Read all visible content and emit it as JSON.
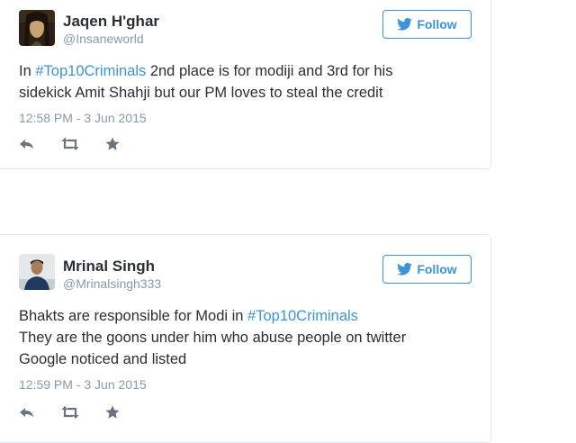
{
  "tweets": [
    {
      "display_name": "Jaqen H'ghar",
      "handle": "@Insaneworld",
      "follow_label": "Follow",
      "text_lines": [
        {
          "before": "In ",
          "hashtag": "#Top10Criminals",
          "after": " 2nd place is for modiji and 3rd for his"
        },
        {
          "before": "sidekick Amit Shahji but our PM loves to steal the credit",
          "hashtag": "",
          "after": ""
        }
      ],
      "timestamp": "12:58 PM - 3 Jun 2015"
    },
    {
      "display_name": "Mrinal Singh",
      "handle": "@Mrinalsingh333",
      "follow_label": "Follow",
      "text_lines": [
        {
          "before": "Bhakts are responsible for Modi in ",
          "hashtag": "#Top10Criminals",
          "after": ""
        },
        {
          "before": "They are the goons under him who abuse people on twitter",
          "hashtag": "",
          "after": ""
        },
        {
          "before": "Google noticed and listed",
          "hashtag": "",
          "after": ""
        }
      ],
      "timestamp": "12:59 PM - 3 Jun 2015"
    }
  ],
  "icons": {
    "follow": "twitter-bird-icon",
    "reply": "reply-icon",
    "retweet": "retweet-icon",
    "favorite": "star-icon"
  },
  "colors": {
    "accent": "#3b94d9",
    "text": "#292f33",
    "muted": "#8899a6",
    "action_icon": "#66757f",
    "border": "#e1e8ed"
  }
}
